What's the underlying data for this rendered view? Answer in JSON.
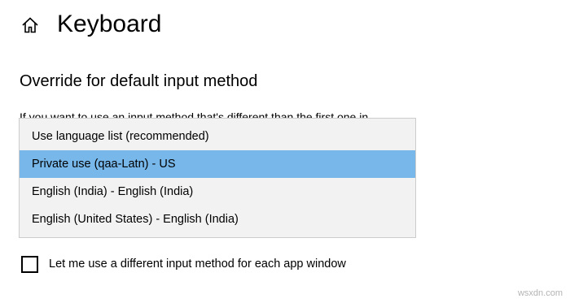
{
  "header": {
    "home_icon": "home-icon",
    "title": "Keyboard"
  },
  "section": {
    "title": "Override for default input method",
    "description": "If you want to use an input method that's different than the first one in"
  },
  "dropdown": {
    "selected_index": 1,
    "selected_color": "#77b7ea",
    "options": [
      {
        "label": "Use language list (recommended)"
      },
      {
        "label": "Private use (qaa-Latn) - US"
      },
      {
        "label": "English (India) - English (India)"
      },
      {
        "label": "English (United States) - English (India)"
      }
    ]
  },
  "checkbox": {
    "label": "Let me use a different input method for each app window",
    "checked": false
  },
  "watermark": "wsxdn.com"
}
